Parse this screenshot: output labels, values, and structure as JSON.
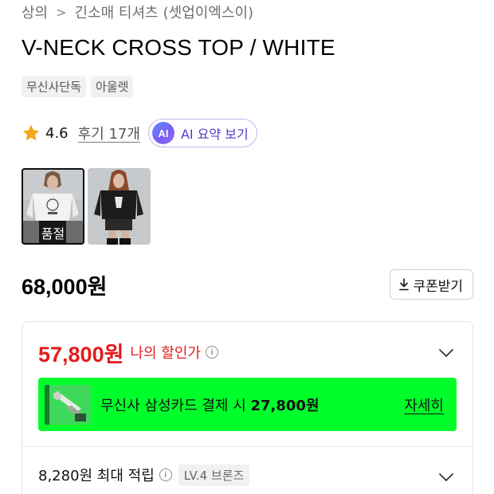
{
  "breadcrumb": {
    "category": "상의",
    "separator": ">",
    "subcategory": "긴소매 티셔츠",
    "brand": "(셋업이엑스이)"
  },
  "product": {
    "title": "V-NECK CROSS TOP / WHITE",
    "tags": [
      "무신사단독",
      "아울렛"
    ]
  },
  "rating": {
    "icon": "star-icon",
    "value": "4.6",
    "review_label": "후기 17개",
    "ai_badge": "AI",
    "ai_summary_label": "AI 요약 보기",
    "star_color": "#f2a81d"
  },
  "thumbnails": [
    {
      "alt": "white-top-model",
      "selected": true,
      "overlay": "품절"
    },
    {
      "alt": "black-top-model",
      "selected": false
    }
  ],
  "price": {
    "original": "68,000원",
    "coupon_button": "쿠폰받기",
    "coupon_icon": "download-icon"
  },
  "discount": {
    "sale_price": "57,800원",
    "sale_label": "나의 할인가",
    "sale_color": "#e31c1c",
    "card_banner": {
      "prefix": "무신사 삼성카드 결제 시 ",
      "amount": "27,800원",
      "detail_link": "자세히",
      "bg_color": "#00ff2a"
    },
    "points": {
      "text": "8,280원 최대 적립",
      "level_badge": "LV.4 브론즈"
    }
  }
}
